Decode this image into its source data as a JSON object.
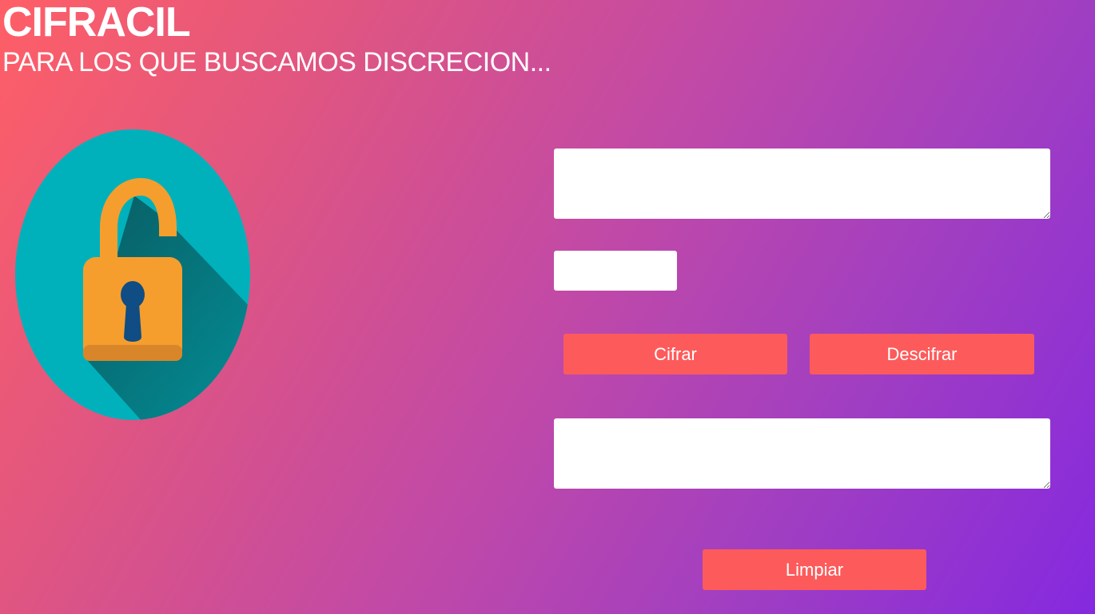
{
  "header": {
    "title": "CIFRACIL",
    "subtitle": "PARA LOS QUE BUSCAMOS DISCRECION..."
  },
  "illustration": {
    "icon": "open-padlock-icon",
    "circle_color": "#00b1bc",
    "lock_color": "#f59e2e",
    "keyhole_color": "#0f4d84"
  },
  "form": {
    "input_text": {
      "value": "",
      "placeholder": ""
    },
    "key_field": {
      "value": "",
      "placeholder": ""
    },
    "output_text": {
      "value": "",
      "placeholder": ""
    }
  },
  "buttons": {
    "cifrar": "Cifrar",
    "descifrar": "Descifrar",
    "limpiar": "Limpiar"
  },
  "colors": {
    "gradient_start": "#ff5f66",
    "gradient_end": "#8529df",
    "button": "#fd5b5b"
  }
}
